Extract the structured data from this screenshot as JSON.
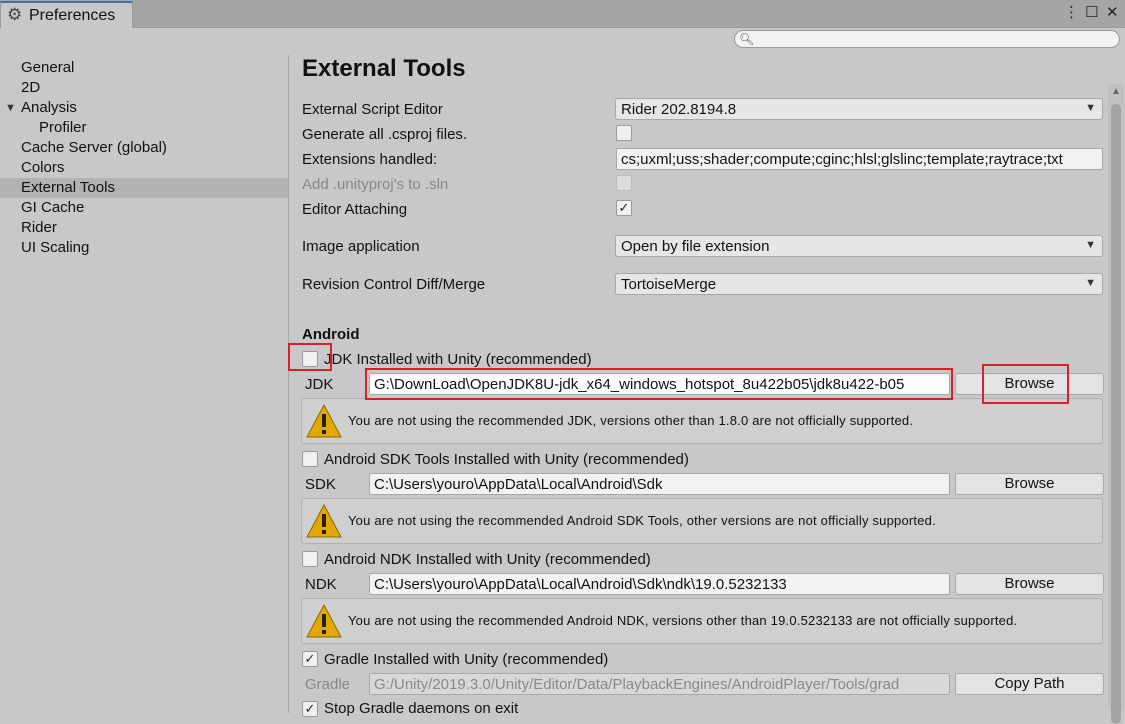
{
  "window": {
    "tab_title": "Preferences",
    "controls": [
      "⋮",
      "☐",
      "✕"
    ]
  },
  "search": {
    "placeholder": "",
    "value": ""
  },
  "sidebar": {
    "items": [
      {
        "label": "General"
      },
      {
        "label": "2D"
      },
      {
        "label": "Analysis"
      },
      {
        "label": "Profiler"
      },
      {
        "label": "Cache Server (global)"
      },
      {
        "label": "Colors"
      },
      {
        "label": "External Tools"
      },
      {
        "label": "GI Cache"
      },
      {
        "label": "Rider"
      },
      {
        "label": "UI Scaling"
      }
    ],
    "selected": "External Tools"
  },
  "content": {
    "title": "External Tools",
    "external_script_editor": {
      "label": "External Script Editor",
      "value": "Rider 202.8194.8"
    },
    "generate_csproj": {
      "label": "Generate all .csproj files.",
      "checked": false
    },
    "extensions_handled": {
      "label": "Extensions handled:",
      "value": "cs;uxml;uss;shader;compute;cginc;hlsl;glslinc;template;raytrace;txt"
    },
    "add_unityproj": {
      "label": "Add .unityproj's to .sln",
      "checked": false
    },
    "editor_attaching": {
      "label": "Editor Attaching",
      "checked": true,
      "mark": "✓"
    },
    "image_application": {
      "label": "Image application",
      "value": "Open by file extension"
    },
    "revision_control": {
      "label": "Revision Control Diff/Merge",
      "value": "TortoiseMerge"
    },
    "android": {
      "title": "Android",
      "jdk": {
        "toggle_label": "JDK Installed with Unity (recommended)",
        "field_label": "JDK",
        "path": "G:\\DownLoad\\OpenJDK8U-jdk_x64_windows_hotspot_8u422b05\\jdk8u422-b05",
        "button": "Browse",
        "warning": "You are not using the recommended JDK, versions other than 1.8.0 are not officially supported."
      },
      "sdk": {
        "toggle_label": "Android SDK Tools Installed with Unity (recommended)",
        "field_label": "SDK",
        "path": "C:\\Users\\youro\\AppData\\Local\\Android\\Sdk",
        "button": "Browse",
        "warning": "You are not using the recommended Android SDK Tools, other versions are not officially supported."
      },
      "ndk": {
        "toggle_label": "Android NDK Installed with Unity (recommended)",
        "field_label": "NDK",
        "path": "C:\\Users\\youro\\AppData\\Local\\Android\\Sdk\\ndk\\19.0.5232133",
        "button": "Browse",
        "warning": "You are not using the recommended Android NDK, versions other than 19.0.5232133 are not officially supported."
      },
      "gradle": {
        "toggle_label": "Gradle Installed with Unity (recommended)",
        "checked": true,
        "mark": "✓",
        "field_label": "Gradle",
        "path": "G:/Unity/2019.3.0/Unity/Editor/Data/PlaybackEngines/AndroidPlayer/Tools/grad",
        "button": "Copy Path"
      },
      "stop_gradle": {
        "label": "Stop Gradle daemons on exit",
        "checked": true,
        "mark": "✓"
      }
    }
  },
  "colors": {
    "highlight": "#d8202a",
    "warning_yellow": "#e0a800",
    "selected_bg": "#b2b2b2"
  }
}
